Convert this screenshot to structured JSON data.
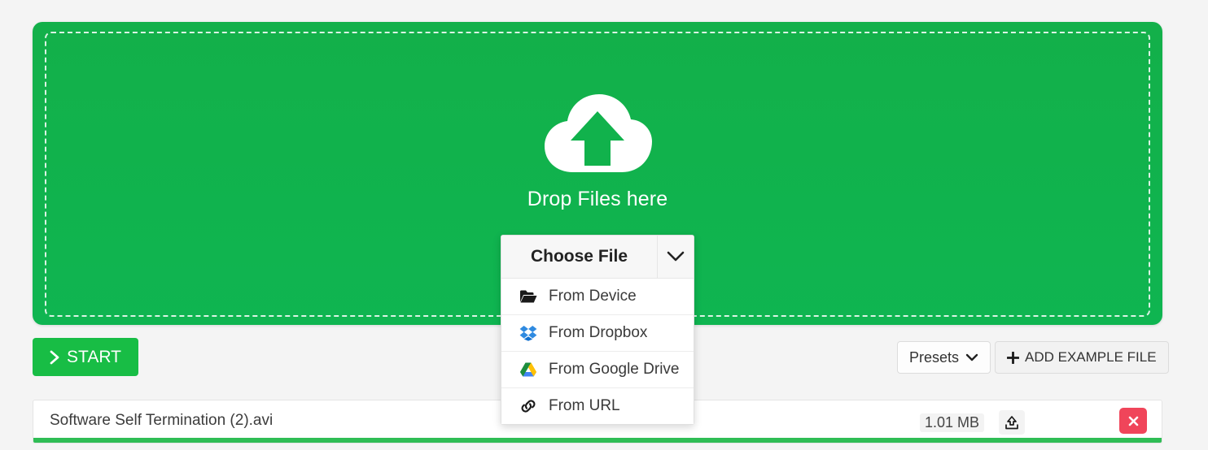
{
  "dropzone": {
    "label": "Drop Files here",
    "icon": "cloud-upload-icon",
    "background_color": "#11b24c"
  },
  "chooser": {
    "title": "Choose File",
    "caret_icon": "chevron-down-icon",
    "items": [
      {
        "label": "From Device",
        "icon": "folder-open-icon"
      },
      {
        "label": "From Dropbox",
        "icon": "dropbox-icon"
      },
      {
        "label": "From Google Drive",
        "icon": "google-drive-icon"
      },
      {
        "label": "From URL",
        "icon": "link-icon"
      }
    ]
  },
  "actions": {
    "start_label": "START",
    "start_icon": "chevron-right-icon",
    "start_color": "#18bd45",
    "presets_label": "Presets",
    "presets_icon": "chevron-down-icon",
    "add_example_label": "ADD EXAMPLE FILE",
    "add_example_icon": "plus-icon"
  },
  "file": {
    "name": "Software Self Termination (2).avi",
    "size": "1.01 MB",
    "upload_icon": "upload-tray-icon",
    "delete_icon": "close-x-icon",
    "delete_color": "#f0455a",
    "progress_percent": 100,
    "progress_color": "#2fbd55"
  }
}
